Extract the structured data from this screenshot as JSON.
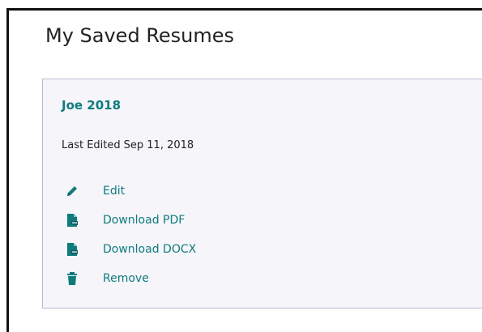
{
  "page": {
    "title": "My Saved Resumes"
  },
  "resume": {
    "name": "Joe 2018",
    "last_edited_label": "Last Edited",
    "last_edited_date": "Sep 11, 2018"
  },
  "actions": [
    {
      "label": "Edit",
      "icon": "pencil-icon"
    },
    {
      "label": "Download PDF",
      "icon": "pdf-file-icon"
    },
    {
      "label": "Download DOCX",
      "icon": "docx-file-icon"
    },
    {
      "label": "Remove",
      "icon": "trash-icon"
    }
  ],
  "colors": {
    "accent": "#0f7b7d",
    "card_background": "#f5f5fa",
    "card_border": "#b8bcd0"
  }
}
